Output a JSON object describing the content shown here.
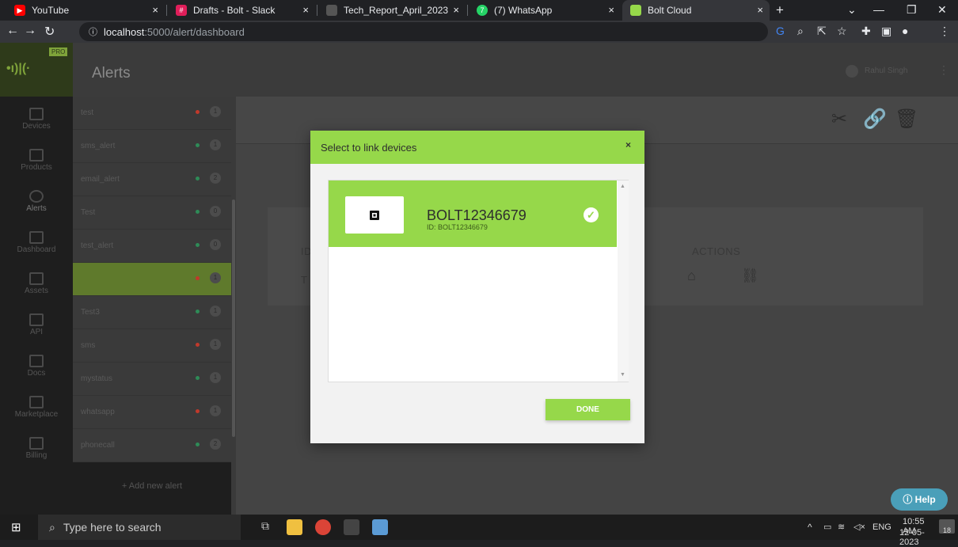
{
  "browser": {
    "tabs": [
      {
        "title": "YouTube",
        "icon": "youtube-icon",
        "color": "#ff0000"
      },
      {
        "title": "Drafts - Bolt - Slack",
        "icon": "slack-icon",
        "color": "#e01e5a"
      },
      {
        "title": "Tech_Report_April_2023",
        "icon": "apple-icon",
        "color": "#cccccc"
      },
      {
        "title": "(7) WhatsApp",
        "icon": "whatsapp-icon",
        "color": "#25d366",
        "badge": "7"
      },
      {
        "title": "Bolt Cloud",
        "icon": "bolt-icon",
        "color": "#96d84a",
        "active": true
      }
    ],
    "close_glyph": "×",
    "new_tab": "+",
    "url_host": "localhost",
    "url_path": ":5000/alert/dashboard"
  },
  "header": {
    "title": "Alerts",
    "user": "Rahul Singh",
    "logo_badge": "PRO"
  },
  "sidebar": [
    {
      "label": "Devices",
      "icon": "devices-icon"
    },
    {
      "label": "Products",
      "icon": "products-icon"
    },
    {
      "label": "Alerts",
      "icon": "alerts-icon",
      "active": true
    },
    {
      "label": "Dashboard",
      "icon": "dashboard-icon"
    },
    {
      "label": "Assets",
      "icon": "assets-icon"
    },
    {
      "label": "API",
      "icon": "api-icon"
    },
    {
      "label": "Docs",
      "icon": "docs-icon"
    },
    {
      "label": "Marketplace",
      "icon": "marketplace-icon"
    },
    {
      "label": "Billing",
      "icon": "billing-icon"
    }
  ],
  "alerts": [
    {
      "name": "test",
      "status": "#c0392b",
      "count": "1"
    },
    {
      "name": "sms_alert",
      "status": "#2e8b57",
      "count": "1"
    },
    {
      "name": "email_alert",
      "status": "#2e8b57",
      "count": "2"
    },
    {
      "name": "Test",
      "status": "#2e8b57",
      "count": "0"
    },
    {
      "name": "test_alert",
      "status": "#2e8b57",
      "count": "0"
    },
    {
      "name": "",
      "status": "#c0392b",
      "count": "1",
      "active": true
    },
    {
      "name": "Test3",
      "status": "#2e8b57",
      "count": "1"
    },
    {
      "name": "sms",
      "status": "#c0392b",
      "count": "1"
    },
    {
      "name": "mystatus",
      "status": "#2e8b57",
      "count": "1"
    },
    {
      "name": "whatsapp",
      "status": "#c0392b",
      "count": "1"
    },
    {
      "name": "phonecall",
      "status": "#2e8b57",
      "count": "2"
    }
  ],
  "add_alert": "+ Add new alert",
  "card": {
    "col_id": "ID",
    "col_actions": "ACTIONS",
    "row_id_first_letter": "T"
  },
  "help": "Help",
  "modal": {
    "title": "Select to link devices",
    "close": "×",
    "device": {
      "name": "BOLT12346679",
      "id_text": "ID: BOLT12346679",
      "selected": true
    },
    "done": "DONE"
  },
  "taskbar": {
    "search_placeholder": "Type here to search",
    "lang": "ENG",
    "time": "10:55 AM",
    "date": "12-05-2023",
    "notifications": "18"
  }
}
